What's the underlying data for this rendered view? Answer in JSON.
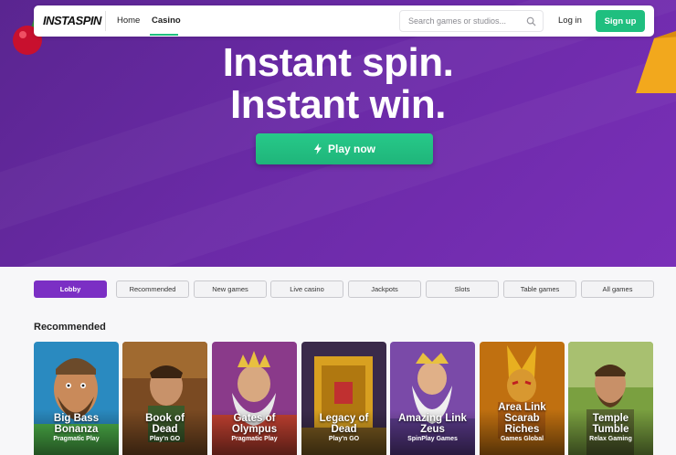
{
  "nav": {
    "logo": "INSTASPIN",
    "links": [
      "Home",
      "Casino"
    ],
    "active_link": "Casino",
    "search_placeholder": "Search games or studios...",
    "login_label": "Log in",
    "signup_label": "Sign up"
  },
  "hero": {
    "headline_line1": "Instant spin.",
    "headline_line2": "Instant win.",
    "play_label": "Play now",
    "background_color": "#6a2aa6",
    "accent_color": "#1fbf7f"
  },
  "tabs": {
    "items": [
      "Lobby",
      "Recommended",
      "New games",
      "Live casino",
      "Jackpots",
      "Slots",
      "Table games",
      "All games"
    ],
    "active": "Lobby"
  },
  "section": {
    "title": "Recommended"
  },
  "games": [
    {
      "title_line1": "Big Bass",
      "title_line2": "Bonanza",
      "provider": "Pragmatic Play"
    },
    {
      "title_line1": "Book of",
      "title_line2": "Dead",
      "provider": "Play'n GO"
    },
    {
      "title_line1": "Gates of",
      "title_line2": "Olympus",
      "provider": "Pragmatic Play"
    },
    {
      "title_line1": "Legacy of",
      "title_line2": "Dead",
      "provider": "Play'n GO"
    },
    {
      "title_line1": "Amazing Link",
      "title_line2": "Zeus",
      "provider": "SpinPlay Games"
    },
    {
      "title_line1": "Area Link",
      "title_line2": "Scarab",
      "title_line3": "Riches",
      "provider": "Games Global"
    },
    {
      "title_line1": "Temple",
      "title_line2": "Tumble",
      "provider": "Relax Gaming"
    }
  ]
}
